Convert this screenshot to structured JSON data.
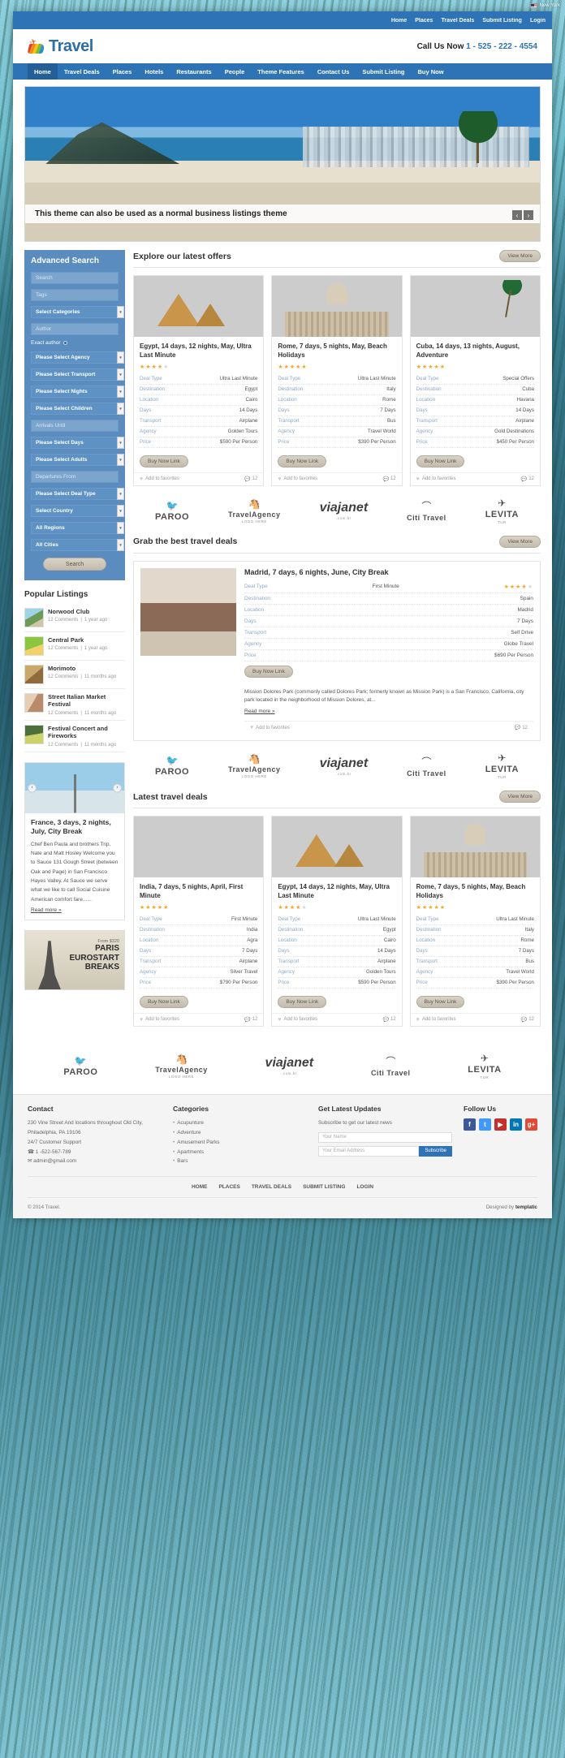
{
  "topbar": {
    "location": "New York",
    "flag_icon": "us-flag-icon"
  },
  "utilnav": {
    "items": [
      "Home",
      "Places",
      "Travel Deals",
      "Submit Listing",
      "Login"
    ]
  },
  "header": {
    "brand": "Travel",
    "call_label": "Call Us Now",
    "phone": "1 - 525 - 222 - 4554"
  },
  "mainnav": {
    "items": [
      "Home",
      "Travel Deals",
      "Places",
      "Hotels",
      "Restaurants",
      "People",
      "Theme Features",
      "Contact Us",
      "Submit Listing",
      "Buy Now"
    ],
    "active": "Home"
  },
  "hero": {
    "caption": "This theme can also be used as a normal business listings theme",
    "prev": "‹",
    "next": "›"
  },
  "advanced_search": {
    "title": "Advanced Search",
    "fields": [
      {
        "label": "Search",
        "type": "text"
      },
      {
        "label": "Tags",
        "type": "text"
      },
      {
        "label": "Select Categories",
        "type": "select"
      },
      {
        "label": "Author",
        "type": "text"
      }
    ],
    "exact_author_label": "Exact author",
    "selects": [
      "Please Select Agency",
      "Please Select Transport",
      "Please Select Nights",
      "Please Select Children"
    ],
    "arrivals_until": "Arrivals Until",
    "selects2": [
      "Please Select Days",
      "Please Select Adults"
    ],
    "departures_from": "Departures From",
    "selects3": [
      "Please Select Deal Type",
      "Select Country",
      "All Regions",
      "All Cities"
    ],
    "search_button": "Search"
  },
  "popular_listings": {
    "title": "Popular Listings",
    "items": [
      {
        "name": "Norwood Club",
        "comments": "12 Comments",
        "age": "1 year ago"
      },
      {
        "name": "Central Park",
        "comments": "12 Comments",
        "age": "1 year ago"
      },
      {
        "name": "Morimoto",
        "comments": "12 Comments",
        "age": "11 months ago"
      },
      {
        "name": "Street Italian Market Festival",
        "comments": "12 Comments",
        "age": "11 months ago"
      },
      {
        "name": "Festival Concert and Fireworks",
        "comments": "12 Comments",
        "age": "11 months ago"
      }
    ]
  },
  "side_feature": {
    "title": "France, 3 days, 2 nights, July, City Break",
    "text": "Chef Ben Paula and brothers Trip, Nate and Matt Hosley Welcome you to Sauce 131 Gough Street (between Oak and Page) in San Francisco Hayes Valley. At Sauce we serve what we like to call Social Cuisine American comfort fare......",
    "read_more": "Read more »",
    "prev": "‹",
    "next": "›"
  },
  "paris_banner": {
    "from": "From $320",
    "line1": "PARIS",
    "line2": "EUROSTART",
    "line3": "BREAKS"
  },
  "sections": {
    "offers": {
      "title": "Explore our latest offers",
      "view_more": "View More"
    },
    "best_deals": {
      "title": "Grab the best travel deals",
      "view_more": "View More"
    },
    "latest": {
      "title": "Latest travel deals",
      "view_more": "View More"
    }
  },
  "spec_labels": {
    "deal_type": "Deal Type",
    "destination": "Destination",
    "location": "Location",
    "days": "Days",
    "transport": "Transport",
    "agency": "Agency",
    "price": "Price"
  },
  "card_actions": {
    "buy_now": "Buy Now Link",
    "add_fav": "Add to favorites",
    "comments": "12"
  },
  "offers": [
    {
      "title": "Egypt, 14 days, 12 nights, May, Ultra Last Minute",
      "rating": 4,
      "pic": "pic-pyr",
      "deal_type": "Ultra Last Minute",
      "destination": "Egypt",
      "location": "Cairo",
      "days": "14 Days",
      "transport": "Airplane",
      "agency": "Golden Tours",
      "price": "$590 Per Person"
    },
    {
      "title": "Rome, 7 days, 5 nights, May, Beach Holidays",
      "rating": 5,
      "pic": "pic-rome",
      "deal_type": "Ultra Last Minute",
      "destination": "Italy",
      "location": "Rome",
      "days": "7 Days",
      "transport": "Bus",
      "agency": "Travel World",
      "price": "$390 Per Person"
    },
    {
      "title": "Cuba, 14 days, 13 nights, August, Adventure",
      "rating": 5,
      "pic": "pic-cuba",
      "deal_type": "Special Offers",
      "destination": "Cuba",
      "location": "Havana",
      "days": "14 Days",
      "transport": "Airplane",
      "agency": "Gold Destinations",
      "price": "$450 Per Person"
    }
  ],
  "wide_deal": {
    "title": "Madrid, 7 days, 6 nights, June, City Break",
    "rating": 4,
    "pic": "pic-hotel",
    "deal_type": "First Minute",
    "destination": "Spain",
    "location": "Madrid",
    "days": "7 Days",
    "transport": "Self Drive",
    "agency": "Globe Travel",
    "price": "$690 Per Person",
    "description": "Mission Dolores Park (commonly called Dolores Park; formerly known as Mission Park) is a San Francisco, California, city park located in the neighborhood of Mission Dolores, at...",
    "read_more": "Read more »"
  },
  "latest": [
    {
      "title": "India, 7 days, 5 nights, April, First Minute",
      "rating": 5,
      "pic": "pic-india",
      "deal_type": "First Minute",
      "destination": "India",
      "location": "Agra",
      "days": "7 Days",
      "transport": "Airplane",
      "agency": "Silver Travel",
      "price": "$790 Per Person"
    },
    {
      "title": "Egypt, 14 days, 12 nights, May, Ultra Last Minute",
      "rating": 4,
      "pic": "pic-pyr",
      "deal_type": "Ultra Last Minute",
      "destination": "Egypt",
      "location": "Cairo",
      "days": "14 Days",
      "transport": "Airplane",
      "agency": "Golden Tours",
      "price": "$590 Per Person"
    },
    {
      "title": "Rome, 7 days, 5 nights, May, Beach Holidays",
      "rating": 5,
      "pic": "pic-rome",
      "deal_type": "Ultra Last Minute",
      "destination": "Italy",
      "location": "Rome",
      "days": "7 Days",
      "transport": "Bus",
      "agency": "Travel World",
      "price": "$390 Per Person"
    }
  ],
  "sponsors": [
    {
      "name": "PAROO",
      "sub": "",
      "icon": "bird-icon"
    },
    {
      "name": "TravelAgency",
      "sub": "LOGO HERE",
      "icon": "horse-icon"
    },
    {
      "name": "viajanet",
      "sub": ".com.br",
      "icon": ""
    },
    {
      "name": "Citi Travel",
      "sub": "",
      "icon": "arc-icon"
    },
    {
      "name": "LEVITA",
      "sub": "TUR",
      "icon": "plane-icon"
    }
  ],
  "footer": {
    "contact": {
      "title": "Contact",
      "address": "230 Vine Street And locations throughout Old City, Philadelphia, PA 19106",
      "support": "24/7 Customer Support",
      "phone": "1 -522-567-789",
      "email": "admin@gmail.com"
    },
    "categories": {
      "title": "Categories",
      "items": [
        "Acupunture",
        "Adventure",
        "Amusement Parks",
        "Apartments",
        "Bars"
      ]
    },
    "newsletter": {
      "title": "Get Latest Updates",
      "subtitle": "Subscribe to get our latest news",
      "name_placeholder": "Your Name",
      "email_placeholder": "Your Email Address",
      "button": "Subscribe"
    },
    "follow": {
      "title": "Follow Us",
      "socials": [
        "facebook-icon",
        "twitter-icon",
        "youtube-icon",
        "linkedin-icon",
        "googleplus-icon"
      ]
    },
    "bottom_nav": [
      "HOME",
      "PLACES",
      "TRAVEL DEALS",
      "SUBMIT LISTING",
      "LOGIN"
    ],
    "copyright": "© 2014 Travel.",
    "designed_by": "Designed by",
    "designer": "templatic"
  }
}
